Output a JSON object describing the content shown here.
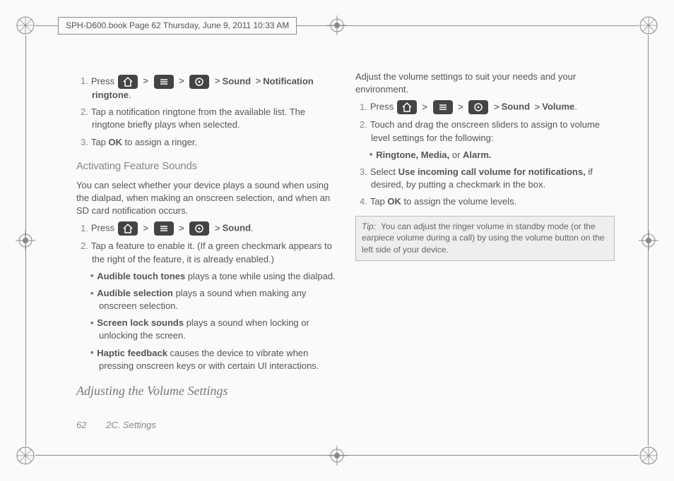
{
  "header": "SPH-D600.book  Page 62  Thursday, June 9, 2011  10:33 AM",
  "footer": {
    "page": "62",
    "section": "2C. Settings"
  },
  "col1": {
    "step1a": "Press ",
    "step1b": "Sound",
    "step1c": "Notification ringtone",
    "step2": "Tap a notification ringtone from the available list. The ringtone briefly plays when selected.",
    "step3a": "Tap ",
    "step3b": "OK",
    "step3c": " to assign a ringer.",
    "sub1": "Activating Feature Sounds",
    "para1": "You can select whether your device plays a sound when using the dialpad, when making an onscreen selection, and when an SD card notification occurs.",
    "s2step1a": "Press ",
    "s2step1b": "Sound",
    "s2step2": "Tap a feature to enable it. (If a green checkmark appears to the right of the feature, it is already enabled.)",
    "b1a": "Audible touch tones",
    "b1b": " plays a tone while using the dialpad.",
    "b2a": "Audible selection",
    "b2b": " plays a sound when making any onscreen selection.",
    "b3a": "Screen lock sounds",
    "b3b": " plays a sound when locking or unlocking the screen."
  },
  "col2": {
    "b4a": "Haptic feedback",
    "b4b": " causes the device to vibrate when pressing onscreen keys or with certain UI interactions.",
    "head2": "Adjusting the Volume Settings",
    "para2": "Adjust the volume settings to suit your needs and your environment.",
    "v1a": "Press ",
    "v1b": "Sound",
    "v1c": "Volume",
    "v2": "Touch and drag the onscreen sliders to assign to volume level settings for the following:",
    "vb1a": "Ringtone, Media,",
    "vb1b": " or ",
    "vb1c": "Alarm.",
    "v3a": "Select ",
    "v3b": "Use incoming call volume for notifications,",
    "v3c": " if desired, by putting a checkmark in the box.",
    "v4a": "Tap ",
    "v4b": "OK",
    "v4c": " to assign the volume levels.",
    "tipLabel": "Tip:",
    "tipBody": "You can adjust the ringer volume in standby mode (or the earpiece volume during a call) by using the volume button on the left side of your device."
  }
}
